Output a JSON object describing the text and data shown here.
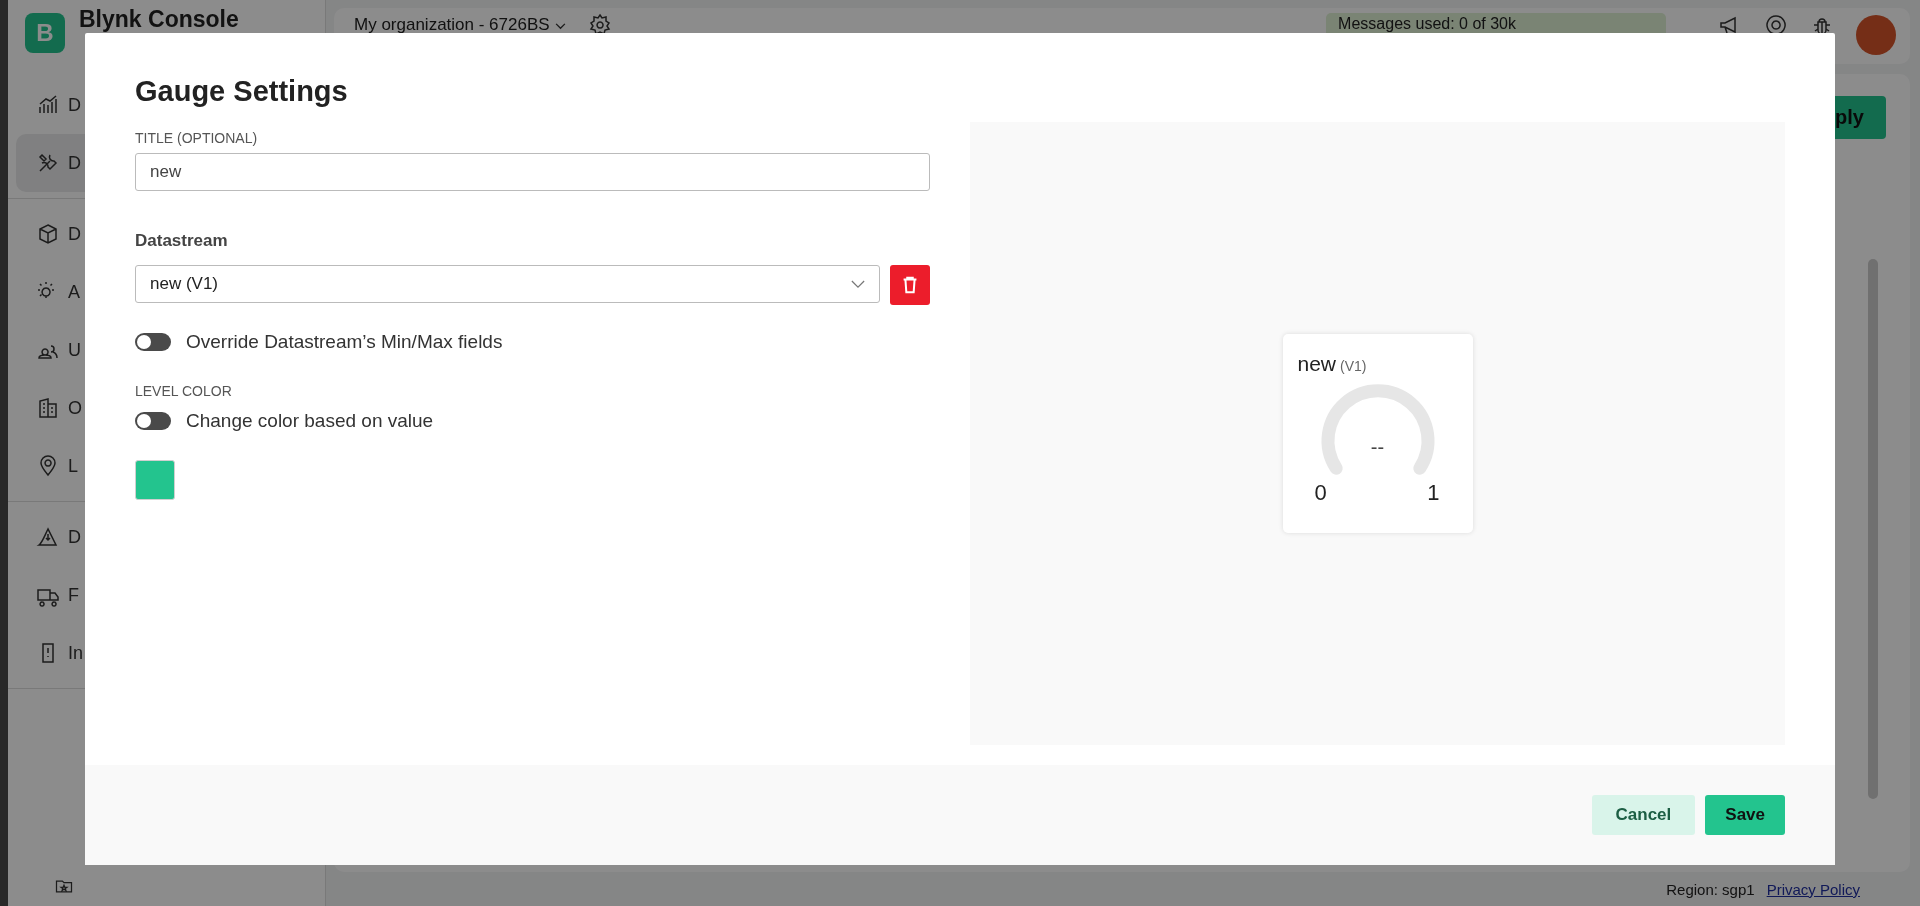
{
  "app": {
    "logo_letter": "B",
    "name": "Blynk Console"
  },
  "sidebar": {
    "sections": [
      [
        {
          "label": "D",
          "selected": false
        },
        {
          "label": "D",
          "selected": true
        }
      ],
      [
        {
          "label": "D",
          "selected": false
        },
        {
          "label": "A",
          "selected": false
        },
        {
          "label": "U",
          "selected": false
        },
        {
          "label": "O",
          "selected": false
        },
        {
          "label": "L",
          "selected": false
        }
      ],
      [
        {
          "label": "D",
          "selected": false
        },
        {
          "label": "F",
          "selected": false
        },
        {
          "label": "In",
          "selected": false
        }
      ]
    ]
  },
  "topbar": {
    "organization": "My organization - 6726BS",
    "messages": "Messages used: 0 of 30k"
  },
  "page": {
    "apply_button": "ply"
  },
  "footer": {
    "region": "Region: sgp1",
    "privacy_link": "Privacy Policy"
  },
  "dialog": {
    "title": "Gauge Settings",
    "title_field": {
      "label": "TITLE (OPTIONAL)",
      "value": "new"
    },
    "datastream": {
      "label": "Datastream",
      "value": "new (V1)"
    },
    "override_toggle": {
      "label": "Override Datastream’s Min/Max fields",
      "on": false
    },
    "level_color": {
      "label": "LEVEL COLOR",
      "toggle_label": "Change color based on value",
      "on": false,
      "color": "#23c48e"
    },
    "preview": {
      "title": "new",
      "pin": "(V1)",
      "value": "--",
      "min": "0",
      "max": "1"
    },
    "buttons": {
      "cancel": "Cancel",
      "save": "Save"
    }
  }
}
